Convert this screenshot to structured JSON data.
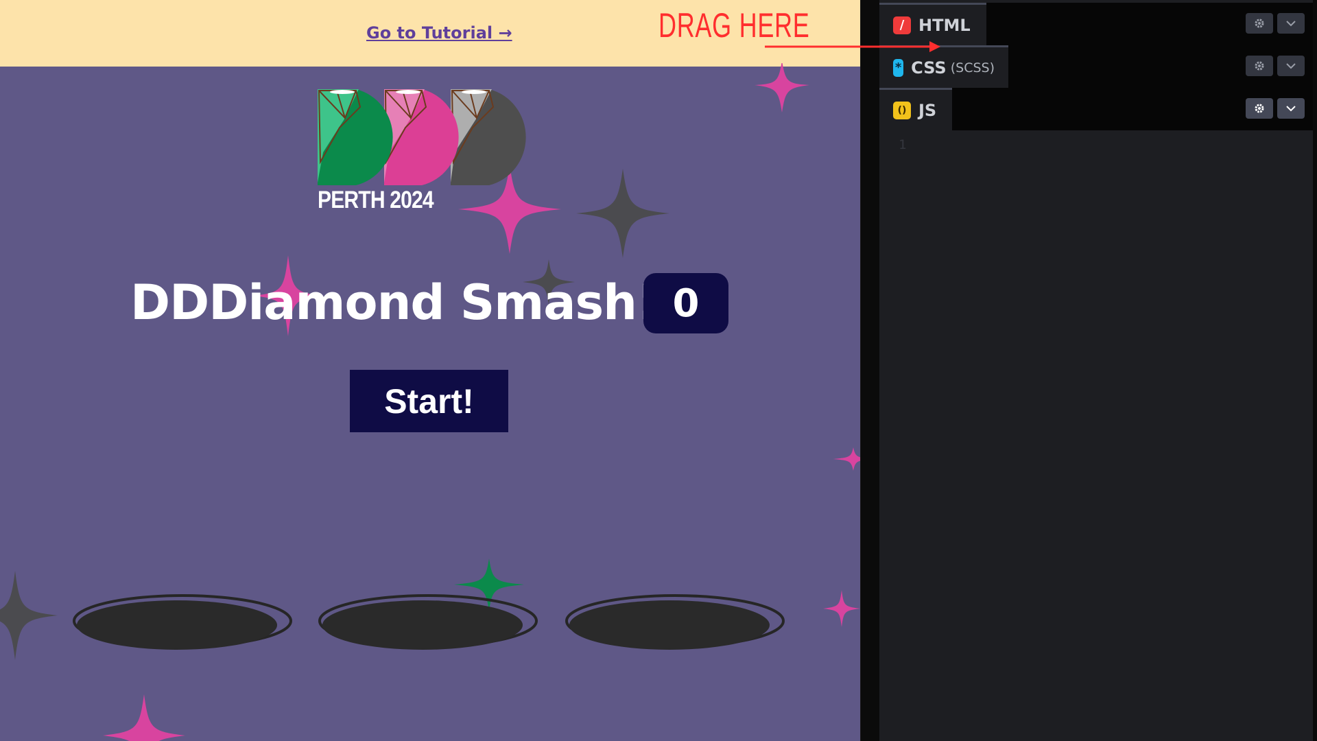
{
  "preview": {
    "tutorial_link": "Go to Tutorial →",
    "logo_caption": "PERTH 2024",
    "title": "DDDiamond Smash!",
    "score": "0",
    "start_button": "Start!"
  },
  "annotation": {
    "text": "DRAG HERE"
  },
  "editor": {
    "panes": [
      {
        "name": "html",
        "label": "HTML",
        "sublabel": "",
        "icon": "html-icon",
        "icon_glyph": "/",
        "icon_color": "#ef3b3b"
      },
      {
        "name": "css",
        "label": "CSS",
        "sublabel": "(SCSS)",
        "icon": "css-icon",
        "icon_glyph": "*",
        "icon_color": "#1fb7ee"
      },
      {
        "name": "js",
        "label": "JS",
        "sublabel": "",
        "icon": "js-icon",
        "icon_glyph": "()",
        "icon_color": "#f2c21b"
      }
    ],
    "line_number": "1"
  },
  "colors": {
    "preview_bg": "#5f5887",
    "banner_bg": "#fde3aa",
    "dark_navy": "#0f0c45",
    "sparkle_pink": "#d8449f",
    "sparkle_gray": "#4b4b4f",
    "sparkle_green": "#0b8a4b",
    "annotation_red": "#ff2e2e",
    "editor_bg": "#1d1e22"
  }
}
